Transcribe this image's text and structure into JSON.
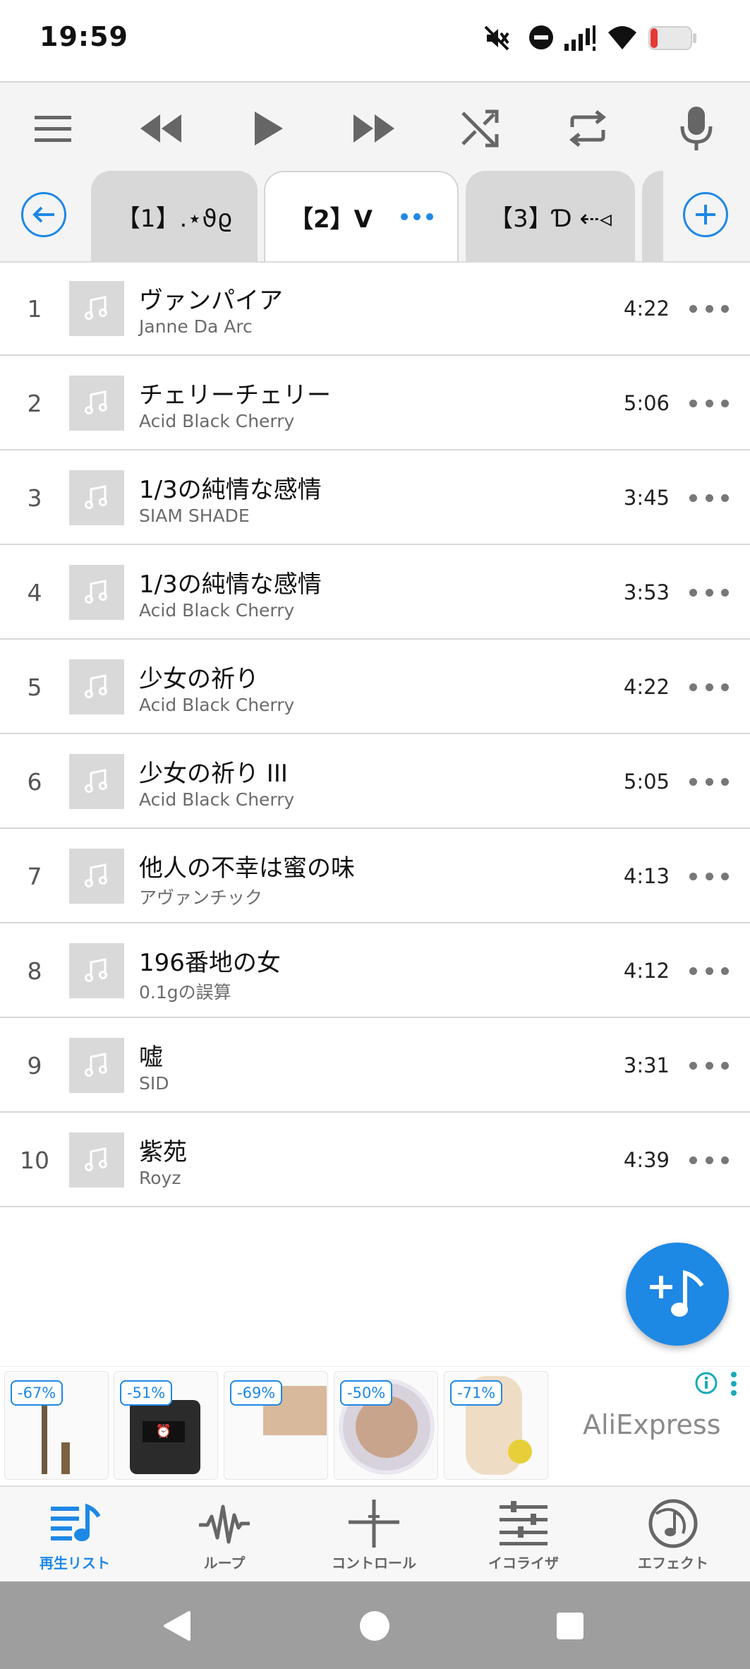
{
  "status_bar": {
    "time": "19:59"
  },
  "tabs": [
    {
      "label": "【1】.⋆ϑϱ",
      "active": false
    },
    {
      "label": "【2】V",
      "active": true
    },
    {
      "label": "【3】Ɗ ⇠◃",
      "active": false
    }
  ],
  "tracks": [
    {
      "num": "1",
      "title": "ヴァンパイア",
      "artist": "Janne Da Arc",
      "duration": "4:22"
    },
    {
      "num": "2",
      "title": "チェリーチェリー",
      "artist": "Acid Black Cherry",
      "duration": "5:06"
    },
    {
      "num": "3",
      "title": "1/3の純情な感情",
      "artist": "SIAM SHADE",
      "duration": "3:45"
    },
    {
      "num": "4",
      "title": "1/3の純情な感情",
      "artist": "Acid Black Cherry",
      "duration": "3:53"
    },
    {
      "num": "5",
      "title": "少女の祈り",
      "artist": "Acid Black Cherry",
      "duration": "4:22"
    },
    {
      "num": "6",
      "title": "少女の祈り III",
      "artist": "Acid Black Cherry",
      "duration": "5:05"
    },
    {
      "num": "7",
      "title": "他人の不幸は蜜の味",
      "artist": "アヴァンチック",
      "duration": "4:13"
    },
    {
      "num": "8",
      "title": "196番地の女",
      "artist": "0.1gの誤算",
      "duration": "4:12"
    },
    {
      "num": "9",
      "title": "嘘",
      "artist": "SID",
      "duration": "3:31"
    },
    {
      "num": "10",
      "title": "紫苑",
      "artist": "Royz",
      "duration": "4:39"
    }
  ],
  "ad": {
    "brand": "AliExpress",
    "discounts": [
      "-67%",
      "-51%",
      "-69%",
      "-50%",
      "-71%"
    ]
  },
  "bottom_nav": [
    {
      "label": "再生リスト",
      "active": true,
      "icon": "playlist-icon"
    },
    {
      "label": "ループ",
      "active": false,
      "icon": "waveform-icon"
    },
    {
      "label": "コントロール",
      "active": false,
      "icon": "crosshair-icon"
    },
    {
      "label": "イコライザ",
      "active": false,
      "icon": "equalizer-icon"
    },
    {
      "label": "エフェクト",
      "active": false,
      "icon": "effect-icon"
    }
  ],
  "colors": {
    "accent": "#1e88e5",
    "thumb": "#d9d9d9",
    "battery_low": "#e53935"
  }
}
